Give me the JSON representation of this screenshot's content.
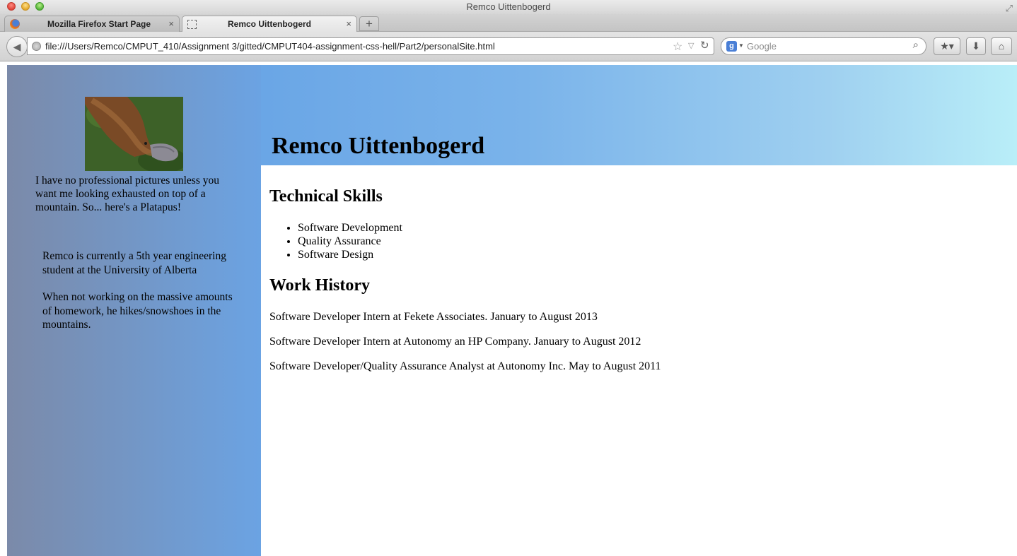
{
  "window": {
    "title": "Remco Uittenbogerd"
  },
  "tabs": [
    {
      "label": "Mozilla Firefox Start Page",
      "close": "×"
    },
    {
      "label": "Remco Uittenbogerd",
      "close": "×"
    }
  ],
  "new_tab": "+",
  "toolbar": {
    "back": "◀",
    "url": "file:///Users/Remco/CMPUT_410/Assignment 3/gitted/CMPUT404-assignment-css-hell/Part2/personalSite.html",
    "star": "☆",
    "dropdown": "▽",
    "reload": "↻",
    "search_engine_glyph": "g",
    "search_dropdown": "▼",
    "search_placeholder": "Google",
    "magnifier": "⌕",
    "bookmarks_glyph": "★▾",
    "download_glyph": "⬇",
    "home_glyph": "⌂"
  },
  "page": {
    "title": "Remco Uittenbogerd",
    "photo_caption": "I have no professional pictures unless you want me looking exhausted on top of a mountain. So... here's a Platapus!",
    "bio": [
      "Remco is currently a 5th year engineering student at the University of Alberta",
      "When not working on the massive amounts of homework, he hikes/snowshoes in the mountains."
    ],
    "skills_heading": "Technical Skills",
    "skills": [
      "Software Development",
      "Quality Assurance",
      "Software Design"
    ],
    "work_heading": "Work History",
    "work": [
      "Software Developer Intern at Fekete Associates. January to August 2013",
      "Software Developer Intern at Autonomy an HP Company. January to August 2012",
      "Software Developer/Quality Assurance Analyst at Autonomy Inc. May to August 2011"
    ]
  },
  "colors": {
    "sidebar_start": "#7b8aa9",
    "sidebar_end": "#6ba3e3",
    "header_start": "#6aa6e6",
    "header_end": "#b9eef8"
  }
}
